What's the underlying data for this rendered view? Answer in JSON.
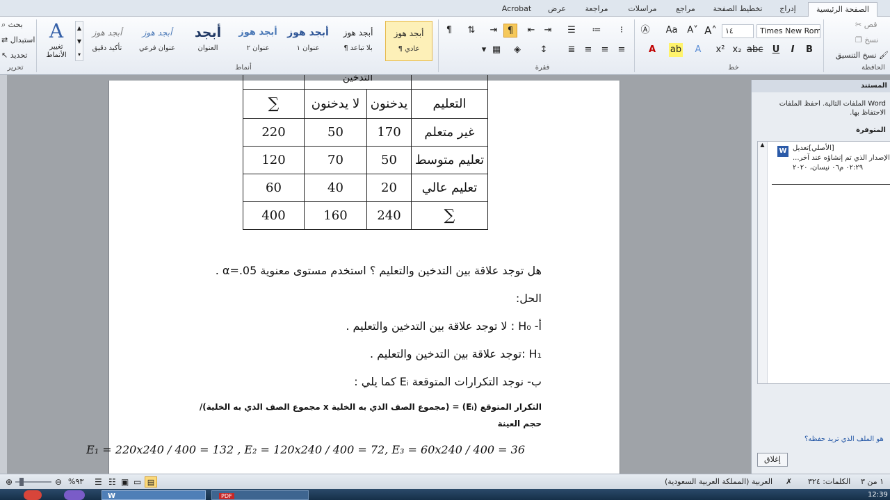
{
  "tabs": [
    {
      "label": "Acrobat",
      "active": false
    },
    {
      "label": "عرض",
      "active": false
    },
    {
      "label": "مراجعة",
      "active": false
    },
    {
      "label": "مراسلات",
      "active": false
    },
    {
      "label": "مراجع",
      "active": false
    },
    {
      "label": "تخطيط الصفحة",
      "active": false
    },
    {
      "label": "إدراج",
      "active": false
    },
    {
      "label": "الصفحة الرئيسية",
      "active": true
    }
  ],
  "ribbon": {
    "clipboard": {
      "cut": "قص",
      "copy": "نسخ",
      "format_painter": "نسخ التنسيق",
      "label": "الحافظة"
    },
    "font": {
      "name": "Times New Roma",
      "size": "١٤",
      "label": "خط"
    },
    "paragraph": {
      "label": "فقرة"
    },
    "styles": {
      "label": "أنماط",
      "items": [
        {
          "preview": "أبجد هوز",
          "name": "¶ عادي",
          "selected": true
        },
        {
          "preview": "أبجد هوز",
          "name": "¶ بلا تباعد",
          "selected": false
        },
        {
          "preview": "أبجد هوز",
          "name": "عنوان ١",
          "selected": false
        },
        {
          "preview": "أبجد هوز",
          "name": "عنوان ٢",
          "selected": false
        },
        {
          "preview": "أبجد",
          "name": "العنوان",
          "selected": false
        },
        {
          "preview": "أبجد هوز",
          "name": "عنوان فرعي",
          "selected": false
        },
        {
          "preview": "أبجد هوز",
          "name": "تأكيد دقيق",
          "selected": false
        }
      ],
      "change_styles": "تغيير الأنماط"
    },
    "editing": {
      "find": "بحث",
      "replace": "استبدال",
      "select": "تحديد",
      "label": "تحرير"
    }
  },
  "document": {
    "table": {
      "header_partial": "التدخين",
      "col_education": "التعليم",
      "col_smokers": "يدخنون",
      "col_nonsmokers": "لا يدخنون",
      "col_sum": "∑",
      "rows": [
        {
          "label": "غير متعلم",
          "smokers": "170",
          "nonsmokers": "50",
          "sum": "220"
        },
        {
          "label": "تعليم متوسط",
          "smokers": "50",
          "nonsmokers": "70",
          "sum": "120"
        },
        {
          "label": "تعليم عالي",
          "smokers": "20",
          "nonsmokers": "40",
          "sum": "60"
        },
        {
          "label": "∑",
          "smokers": "240",
          "nonsmokers": "160",
          "sum": "400"
        }
      ]
    },
    "question": "هل توجد علاقة بين التدخين والتعليم ؟ استخدم مستوى معنوية α=.05 .",
    "solution_label": "الحل:",
    "h0": "أ-   H₀ : لا توجد علاقة بين التدخين والتعليم .",
    "h1": "H₁ :توجد علاقة بين التدخين والتعليم .",
    "b_line": "ب- نوجد التكرارات المتوقعة Eᵢ كما يلي :",
    "formula_text": "التكرار المتوقع (Eᵢ) = (مجموع الصف الذي به الخلية x مجموع الصف الذي به الخلية)/ حجم العينة",
    "equation": "E₁ = 220x240 / 400 = 132 , E₂ = 120x240 / 400 = 72, E₃ = 60x240 / 400 = 36"
  },
  "pane": {
    "title": "المستند",
    "info": "Word الملفات التالية. احفظ الملفات الاحتفاظ بها.",
    "available": "المتوفرة",
    "file_title": "[الأصلي]تعديل",
    "file_desc": "الإصدار الذي تم إنشاؤه عند آخر...",
    "file_time": "٠٢:٢٩ م٠٦ نيسان، ٢٠٢٠",
    "question": "هو الملف الذي تريد حفظه؟",
    "close": "إغلاق"
  },
  "status": {
    "page": "١ من ٣",
    "words": "الكلمات: ٣٢٤",
    "language": "العربية (المملكة العربية السعودية)",
    "zoom": "%٩٣"
  },
  "taskbar": {
    "clock": "12:39"
  }
}
